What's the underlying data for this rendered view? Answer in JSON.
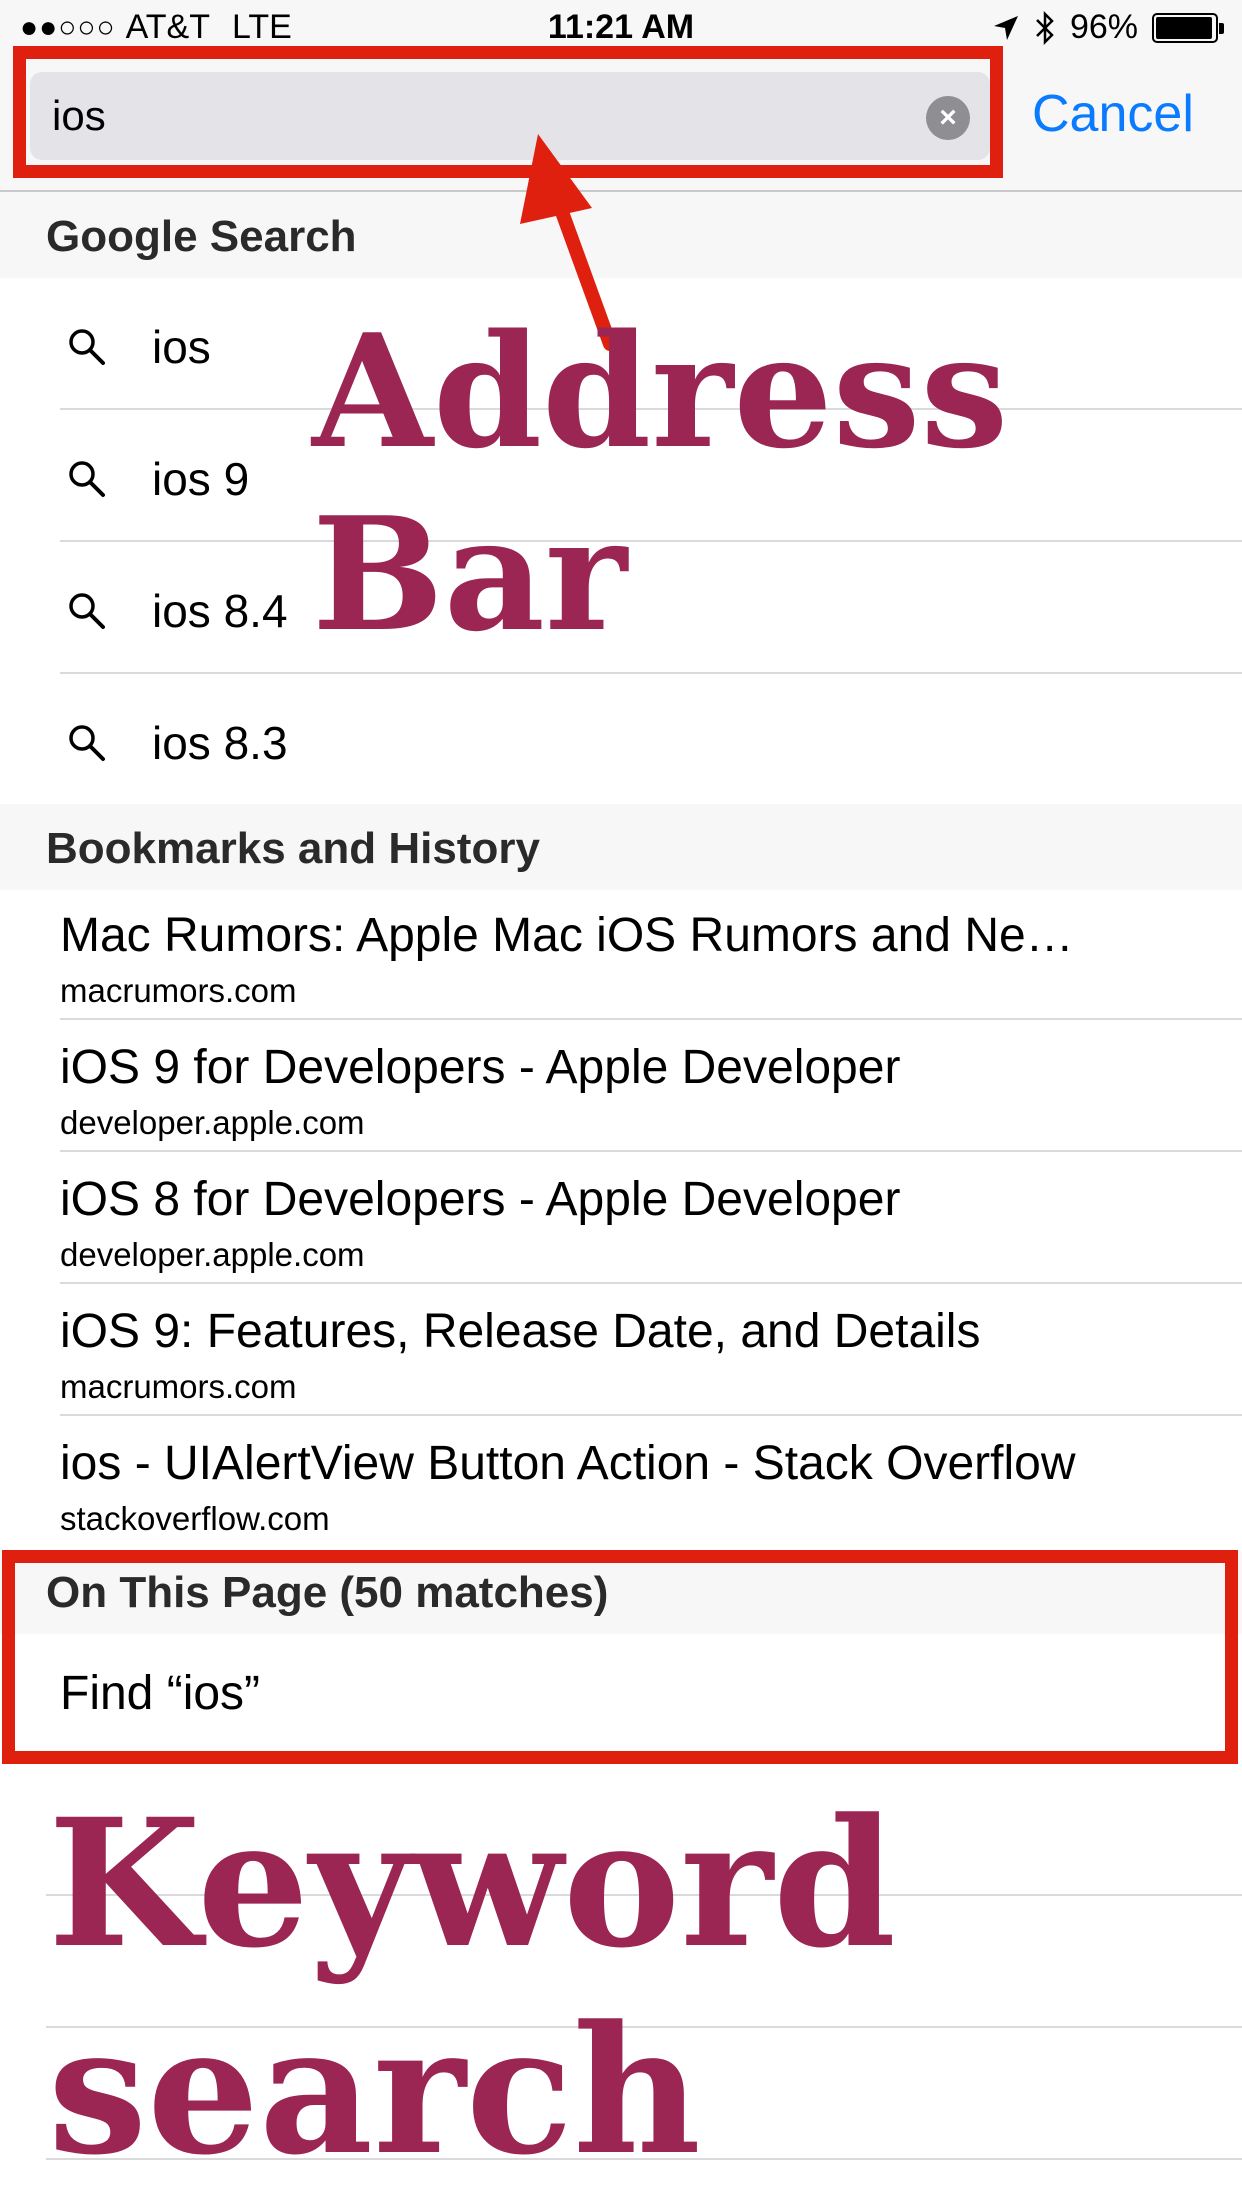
{
  "status_bar": {
    "signal_dots": "●●○○○",
    "carrier": "AT&T",
    "network": "LTE",
    "time": "11:21 AM",
    "battery_text": "96%",
    "battery_level": 0.96
  },
  "search": {
    "value": "ios",
    "cancel_label": "Cancel",
    "clear_glyph": "×"
  },
  "google_search": {
    "header": "Google Search",
    "suggestions": [
      "ios",
      "ios 9",
      "ios 8.4",
      "ios 8.3"
    ]
  },
  "bookmarks_history": {
    "header": "Bookmarks and History",
    "items": [
      {
        "title": "Mac Rumors: Apple Mac iOS Rumors and Ne…",
        "url": "macrumors.com"
      },
      {
        "title": "iOS 9 for Developers - Apple Developer",
        "url": "developer.apple.com"
      },
      {
        "title": "iOS 8 for Developers - Apple Developer",
        "url": "developer.apple.com"
      },
      {
        "title": "iOS 9: Features, Release Date, and Details",
        "url": "macrumors.com"
      },
      {
        "title": "ios - UIAlertView Button Action - Stack Overflow",
        "url": "stackoverflow.com"
      }
    ]
  },
  "on_this_page": {
    "header": "On This Page (50 matches)",
    "find_label": "Find “ios”"
  },
  "annotations": {
    "address_bar": "Address Bar",
    "keyword_search": "Keyword search"
  },
  "colors": {
    "accent": "#0a7aff",
    "highlight_box": "#e0200e",
    "annotation_text": "#9b2654"
  }
}
